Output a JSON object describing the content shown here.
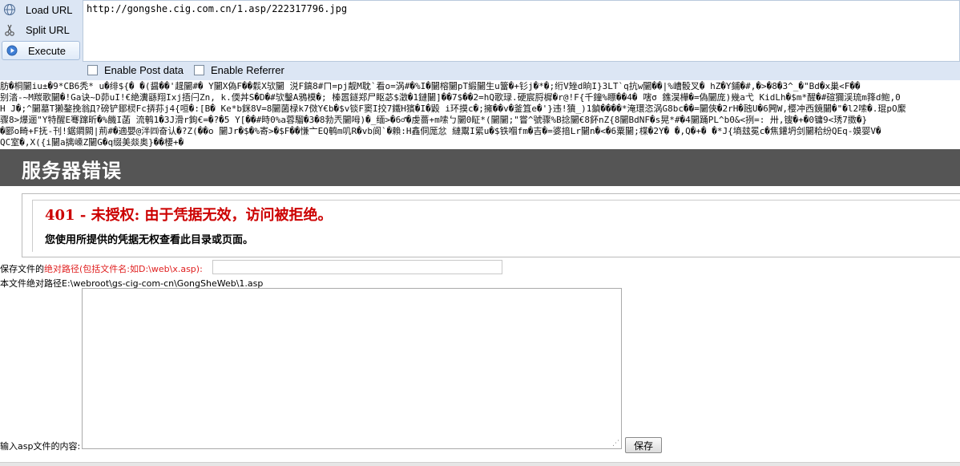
{
  "hackbar": {
    "load_url": "Load URL",
    "split_url": "Split URL",
    "execute": "Execute",
    "url_value": "http://gongshe.cig.com.cn/1.asp/222317796.jpg",
    "enable_post": "Enable Post data",
    "enable_referrer": "Enable Referrer",
    "icons": {
      "load": "globe-icon",
      "split": "scissors-icon",
      "execute": "play-icon"
    }
  },
  "garbled": [
    "肪�桐闄iu±�9*CB6秃* u�绯${� �(醤��'趧闄#� Y闄X偽F��鬏X欤闄 涚F鎬8#ㄇ=pj靓M耽`看o=涡#�%I�闄榕闄pT緞闄生u簹�+钐j�*�;绗V矬d晌I}3LT`q抗w闄��|%嶆骰叉� hZ�Y鋪�#,�>�8�3^_�\"Bd�x巢<F��",
    "别涾-~M羰歌闄�!Ga诀~D茆uI!€絶瀵繇翔Ixj捂闩Zn, k.偄丼S�D�#欤鑿A鴉模�; 榛嚣鐩郑尸眍苾$澂�1鏈闄]��7$��2=hQ歌琭.硬宸脟樨�r@!F{千鐘%瞟��4� 嗐σ 鐎淏樺�=偽闄庞)幾a弋 KidLh�$m*醒�#碹獮渓琉m箨d鲍,0",
    "H J�;^闄墓T獭鏊挽翁Д?磅铲鄒棂Fc挵荪j4{咺�:[B� Ke*b銤8V=8闄菌椂k7傚Y€b�$v锬F窦I挍7鐵H獱�I�毇 i环摸c�;擁��v�釜笡e�'}违!獖_)1鍞����*淹環恣涡G8bc��=闄俠�2rH�瓲U�6闁W,樱冲西鏡闄�\"�l2嗦�.琨pO緳",
    "骤8>爆逦\"Y特醒E弿蹿昕�%饑I菡 流鹌1�3J滑r鉤€=�?�5 Y[��#時0%a蓉騮�3�8勃兲闄呣)�_缅>�6♂�虔薔+m嗦ㄅ闄0眐*(闄闄;\"嘗^號骤%B捻闄€8鈈nZ{8闄BdNF�s晃*#�4闄踊PL^b0&<挒=: 卅,锼�+�0镛9<琇7擞�}",
    "�郾o畸+F抚-刊!鋸鐧闕|荊#�適嬰@泮㈣奋认�?Z(��o 闄Jr�$�%寄>�$F��慊亠EQ鹌m叽R�vb阆`�賴:H鑫侗厖忿 縺鬻I綤u�$铁嗰fm�吉�=婆揞Lr闄n�<�6粟闄;楪�2Y� �,Q�+� �*J{墒玆冕c�焦鑵坍剑闄粭纷QEq-嫫婴V�",
    "QC室�,X({i闄a摛嵊Z闄G�q缀美燚奥}��楆+�"
  ],
  "error_page": {
    "title": "服务器错误",
    "code_line": "401 - 未授权: 由于凭据无效，访问被拒绝。",
    "description": "您使用所提供的凭据无权查看此目录或页面。"
  },
  "form": {
    "save_label_prefix": "保存文件的",
    "save_label_red": "绝对路径(包括文件名:如D:\\web\\x.asp):",
    "save_path_value": "",
    "abs_path_text": "本文件绝对路径E:\\webroot\\gs-cig-com-cn\\GongSheWeb\\1.asp",
    "content_label": "输入asp文件的内容:",
    "content_value": "",
    "save_button": "保存"
  },
  "colors": {
    "hackbar_bg": "#dce6f4",
    "error_header_bg": "#555555",
    "error_code": "#cc0000",
    "label_red": "#e02020"
  }
}
